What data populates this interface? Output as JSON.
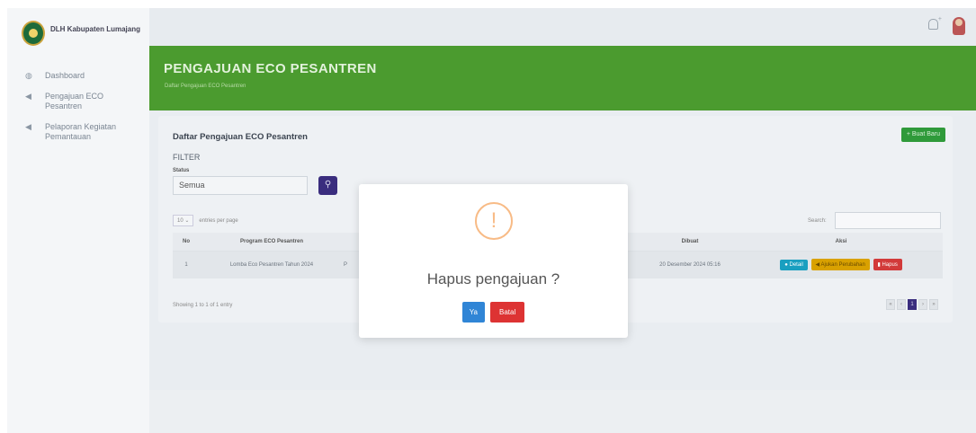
{
  "brand": {
    "name": "DLH Kabupaten Lumajang"
  },
  "sidebar": {
    "items": [
      {
        "label": "Dashboard",
        "icon": "palette-icon"
      },
      {
        "label": "Pengajuan ECO Pesantren",
        "icon": "send-icon"
      },
      {
        "label": "Pelaporan Kegiatan Pemantauan",
        "icon": "send-icon"
      }
    ]
  },
  "header": {
    "title": "PENGAJUAN ECO PESANTREN",
    "subtitle": "Daftar Pengajuan ECO Pesantren"
  },
  "card": {
    "title": "Daftar Pengajuan ECO Pesantren",
    "new_button": "+ Buat Baru",
    "filter_label": "FILTER",
    "status_label": "Status",
    "status_value": "Semua",
    "page_length": "10",
    "page_length_suffix": "entries per page",
    "search_label": "Search:"
  },
  "table": {
    "columns": [
      "No",
      "Program ECO Pesantren",
      "",
      "",
      "Dibuat",
      "Aksi"
    ],
    "rows": [
      {
        "no": "1",
        "program": "Lomba Eco Pesantren Tahun 2024",
        "col3": "P",
        "created": "20 Desember 2024 05:16",
        "actions": {
          "detail": "Detail",
          "ajukan": "Ajukan Perubahan",
          "hapus": "Hapus"
        }
      }
    ],
    "showing": "Showing 1 to 1 of 1 entry",
    "pager": [
      "«",
      "‹",
      "1",
      "›",
      "»"
    ],
    "active_page": "1"
  },
  "modal": {
    "icon": "!",
    "title": "Hapus pengajuan ?",
    "confirm": "Ya",
    "cancel": "Batal"
  }
}
